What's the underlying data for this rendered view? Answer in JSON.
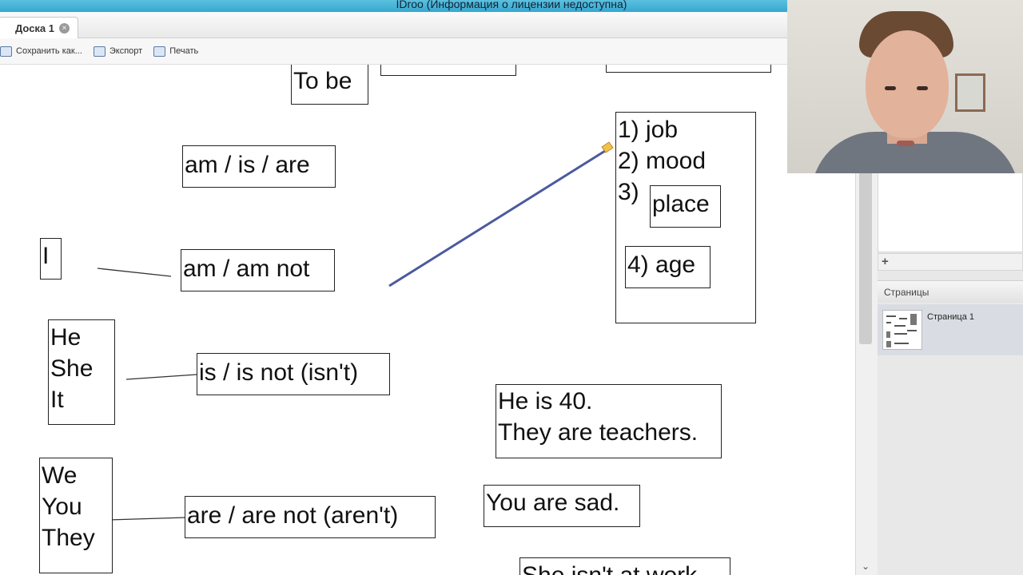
{
  "window": {
    "title": "IDroo (Информация о лицензии недоступна)"
  },
  "tabs": [
    {
      "label": "Доска 1"
    }
  ],
  "toolbar": {
    "save_label": "Сохранить как...",
    "export_label": "Экспорт",
    "print_label": "Печать"
  },
  "board": {
    "to_be": "To be",
    "am_is_are": "am / is / are",
    "pronoun_i": "I",
    "am_not": "am / am not",
    "he_she_it": "He\nShe\nIt",
    "is_not": "is / is not (isn't)",
    "we_you_they": "We\nYou\nThey",
    "are_not": "are / are not (aren't)",
    "uses": "1) job\n2) mood\n3)",
    "place": "place",
    "age": "4) age",
    "example_1": "He is 40.\nThey are teachers.",
    "example_2": "You are sad.",
    "example_3": "She isn't at work."
  },
  "sidebar": {
    "pages_header": "Страницы",
    "pages": [
      {
        "label": "Страница 1"
      }
    ]
  },
  "colors": {
    "title_bar": "#36a7cf",
    "pen_line": "#4b5a9e",
    "pen_highlight": "#f0c24a"
  }
}
